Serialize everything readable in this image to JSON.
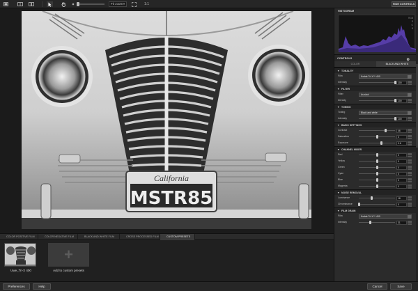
{
  "toolbar": {
    "zoom_mode": "Fit zoom",
    "zoom_ratio": "1:1",
    "hide_controls": "HIDE CONTROLS"
  },
  "photo": {
    "plate_top": "California",
    "plate_text": "MSTR85"
  },
  "film_tabs": [
    {
      "label": "COLOR POSITIVE FILM",
      "active": false
    },
    {
      "label": "COLOR NEGATIVE FILM",
      "active": false
    },
    {
      "label": "BLACK AND WHITE FILM",
      "active": false
    },
    {
      "label": "CROSS PROCESSED FILM",
      "active": false
    },
    {
      "label": "CUSTOM PRESETS",
      "active": true
    }
  ],
  "presets": [
    {
      "label": "Uwe_Tri-X 400"
    },
    {
      "label": "Add to custom presets"
    }
  ],
  "bottom": {
    "preferences": "Preferences",
    "help": "Help",
    "cancel": "Cancel",
    "save": "Save"
  },
  "panel": {
    "histogram_title": "HISTOGRAM",
    "histogram_labels": [
      "RGB",
      "R",
      "G",
      "B"
    ],
    "controls_title": "CONTROLS",
    "tabs": [
      {
        "label": "COLOR",
        "active": false
      },
      {
        "label": "BLACK AND WHITE",
        "active": true
      }
    ],
    "sections": [
      {
        "title": "TONALITY",
        "rows": [
          {
            "label": "Film",
            "type": "select",
            "value": "Kodak Tri-X™ 400"
          },
          {
            "label": "Intensity",
            "type": "slider",
            "value": "100",
            "pos": 1.0
          }
        ]
      },
      {
        "title": "FILTER",
        "rows": [
          {
            "label": "Filter",
            "type": "select",
            "value": "As shot"
          },
          {
            "label": "Density",
            "type": "slider",
            "value": "100",
            "pos": 1.0
          }
        ]
      },
      {
        "title": "TONING",
        "rows": [
          {
            "label": "Toning",
            "type": "select",
            "value": "Black and white"
          },
          {
            "label": "Intensity",
            "type": "slider",
            "value": "100",
            "pos": 1.0
          }
        ]
      },
      {
        "title": "BASIC SETTINGS",
        "rows": [
          {
            "label": "Contrast",
            "type": "slider",
            "value": "46",
            "pos": 0.73
          },
          {
            "label": "Saturation",
            "type": "slider",
            "value": "0",
            "pos": 0.5
          },
          {
            "label": "Exposure",
            "type": "slider",
            "value": "0.6",
            "pos": 0.62
          }
        ]
      },
      {
        "title": "CHANNEL MIXER",
        "rows": [
          {
            "label": "Red",
            "type": "slider",
            "value": "0",
            "pos": 0.5
          },
          {
            "label": "Yellow",
            "type": "slider",
            "value": "0",
            "pos": 0.5
          },
          {
            "label": "Green",
            "type": "slider",
            "value": "0",
            "pos": 0.5
          },
          {
            "label": "Cyan",
            "type": "slider",
            "value": "0",
            "pos": 0.5
          },
          {
            "label": "Blue",
            "type": "slider",
            "value": "0",
            "pos": 0.5
          },
          {
            "label": "Magenta",
            "type": "slider",
            "value": "0",
            "pos": 0.5
          }
        ]
      },
      {
        "title": "NOISE REMOVAL",
        "rows": [
          {
            "label": "Luminance",
            "type": "slider",
            "value": "18",
            "pos": 0.35
          },
          {
            "label": "Chrominance",
            "type": "slider",
            "value": "0",
            "pos": 0.0
          }
        ]
      },
      {
        "title": "FILM GRAIN",
        "rows": [
          {
            "label": "Film",
            "type": "select",
            "value": "Kodak Tri-X™ 400"
          },
          {
            "label": "Intensity",
            "type": "slider",
            "value": "31",
            "pos": 0.31
          }
        ]
      }
    ]
  },
  "colors": {
    "background": "#1e1e1e",
    "panel": "#2b2b2b",
    "histogram_fill": "#5a3fb0"
  },
  "icons": [
    "single-view-icon",
    "split-view-icon",
    "compare-view-icon",
    "select-arrow-icon",
    "hand-tool-icon",
    "zoom-dot-icon",
    "fit-screen-icon",
    "gear-icon"
  ]
}
